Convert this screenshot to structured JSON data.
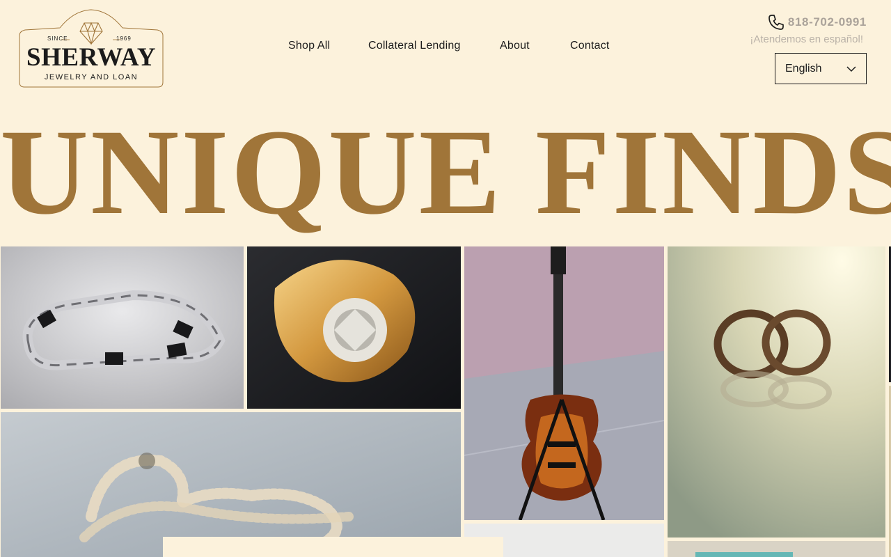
{
  "brand": {
    "since": "SINCE",
    "year": "1969",
    "name": "SHERWAY",
    "tagline": "JEWELRY AND LOAN"
  },
  "nav": {
    "items": [
      {
        "label": "Shop All"
      },
      {
        "label": "Collateral Lending"
      },
      {
        "label": "About"
      },
      {
        "label": "Contact"
      }
    ]
  },
  "contact": {
    "phone": "818-702-0991",
    "spanish_note": "¡Atendemos en español!"
  },
  "language": {
    "selected": "English"
  },
  "hero": {
    "title": "UNIQUE FINDS"
  },
  "colors": {
    "background": "#fcf2dc",
    "accent": "#a07539",
    "text": "#1b1b1b",
    "muted": "#aba39a"
  },
  "gallery": {
    "tiles": [
      {
        "icon": "bracelet-photo"
      },
      {
        "icon": "diamond-ring-photo"
      },
      {
        "icon": "guitar-photo"
      },
      {
        "icon": "wedding-rings-photo"
      },
      {
        "icon": "pearl-necklace-photo"
      }
    ]
  }
}
